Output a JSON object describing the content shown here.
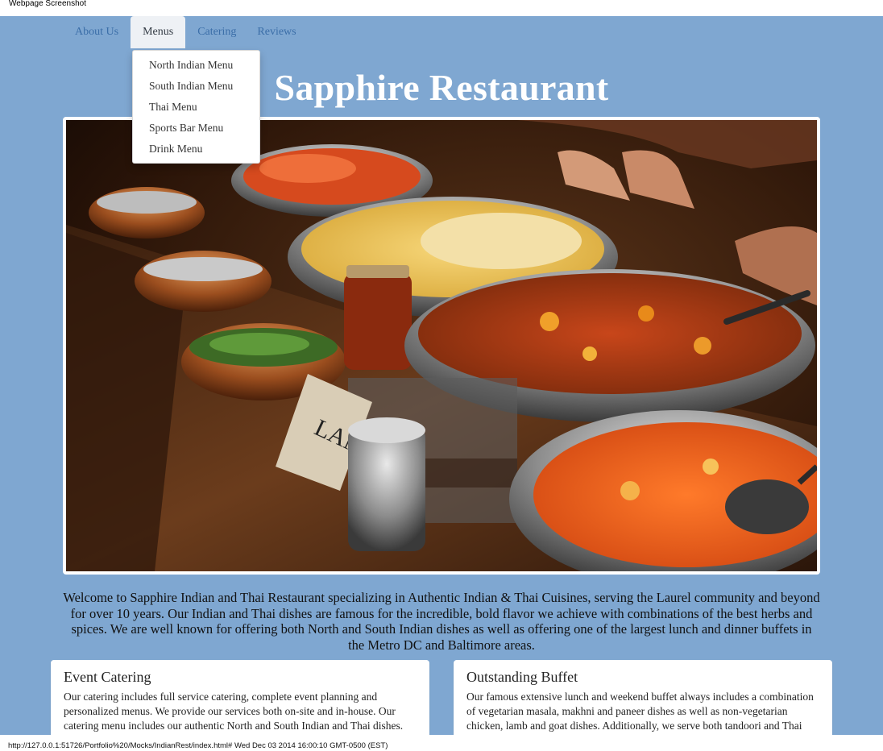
{
  "capture_header": "Webpage Screenshot",
  "nav": {
    "items": [
      {
        "label": "About Us"
      },
      {
        "label": "Menus"
      },
      {
        "label": "Catering"
      },
      {
        "label": "Reviews"
      }
    ]
  },
  "dropdown": {
    "items": [
      {
        "label": "North Indian Menu"
      },
      {
        "label": "South Indian Menu"
      },
      {
        "label": "Thai Menu"
      },
      {
        "label": "Sports Bar Menu"
      },
      {
        "label": "Drink Menu"
      }
    ]
  },
  "site_title": "Sapphire Restaurant",
  "hero_sign_text": "LAMB C",
  "intro": "Welcome to Sapphire Indian and Thai Restaurant specializing in Authentic Indian & Thai Cuisines, serving the Laurel community and beyond for over 10 years. Our Indian and Thai dishes are famous for the incredible, bold flavor we achieve with combinations of the best herbs and spices. We are well known for offering both North and South Indian dishes as well as offering one of the largest lunch and dinner buffets in the Metro DC and Baltimore areas.",
  "cards": [
    {
      "title": "Event Catering",
      "body": "Our catering includes full service catering, complete event planning and personalized menus. We provide our services both on-site and in-house. Our catering menu includes our authentic North and South Indian and Thai dishes."
    },
    {
      "title": "Outstanding Buffet",
      "body": "Our famous extensive lunch and weekend buffet always includes a combination of vegetarian masala, makhni and paneer dishes as well as non-vegetarian chicken, lamb and goat dishes. Additionally, we serve both tandoori and Thai dishes."
    }
  ],
  "status_bar": "http://127.0.0.1:51726/Portfolio%20/Mocks/IndianRest/index.html# Wed Dec 03 2014 16:00:10 GMT-0500 (EST)",
  "colors": {
    "page_background": "#7fa7d1",
    "nav_link": "#3b6ea8",
    "active_tab": "#eef1f5"
  }
}
